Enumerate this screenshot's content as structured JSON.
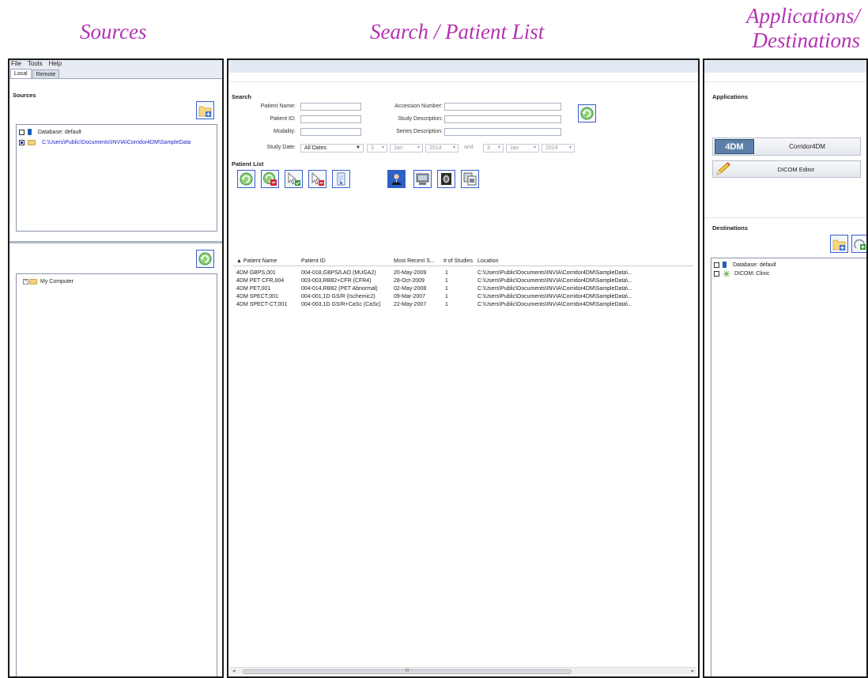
{
  "captions": {
    "sources": "Sources",
    "search": "Search / Patient List",
    "apps_line1": "Applications/",
    "apps_line2": "Destinations"
  },
  "menu": [
    "File",
    "Tools",
    "Help"
  ],
  "tabs": [
    "Local",
    "Remote"
  ],
  "sources": {
    "title": "Sources",
    "items": [
      {
        "label": "Database: default",
        "checked": false
      },
      {
        "label": "C:\\Users\\Public\\Documents\\INVIA\\Corridor4DM\\SampleData",
        "checked": true
      }
    ]
  },
  "tree": {
    "root": "My Computer"
  },
  "search": {
    "title": "Search",
    "patient_name_label": "Patient Name:",
    "patient_id_label": "Patient ID:",
    "modality_label": "Modality:",
    "accession_label": "Accession Number:",
    "study_desc_label": "Study Description:",
    "series_desc_label": "Series Description:",
    "study_date_label": "Study Date:",
    "study_date_value": "All Dates",
    "from_day": "3",
    "from_month": "Jan",
    "from_year": "2014",
    "and_label": "and",
    "to_day": "3",
    "to_month": "Jan",
    "to_year": "2014"
  },
  "patient_list": {
    "title": "Patient List",
    "columns": [
      "▲ Patient Name",
      "Patient ID",
      "Most Recent S...",
      "# of Studies",
      "Location"
    ],
    "rows": [
      [
        "4DM GBPS,001",
        "004-018,GBPS/LAO (MUGA2)",
        "20-May-2009",
        "1",
        "C:\\Users\\Public\\Documents\\INVIA\\Corridor4DM\\SampleData\\..."
      ],
      [
        "4DM PET CFR,004",
        "003-003,RB82+CFR (CFR4)",
        "28-Oct-2009",
        "1",
        "C:\\Users\\Public\\Documents\\INVIA\\Corridor4DM\\SampleData\\..."
      ],
      [
        "4DM PET,001",
        "004-014,RB82 (PET Abnormal)",
        "02-May-2008",
        "1",
        "C:\\Users\\Public\\Documents\\INVIA\\Corridor4DM\\SampleData\\..."
      ],
      [
        "4DM SPECT,001",
        "004-001,1D GS/R (Ischemic2)",
        "09-Mar-2007",
        "1",
        "C:\\Users\\Public\\Documents\\INVIA\\Corridor4DM\\SampleData\\..."
      ],
      [
        "4DM SPECT-CT,001",
        "004-003,1D GS/R+CaSc (CaSc)",
        "22-May-2007",
        "1",
        "C:\\Users\\Public\\Documents\\INVIA\\Corridor4DM\\SampleData\\..."
      ]
    ],
    "scroll_center": "III"
  },
  "applications": {
    "title": "Applications",
    "items": [
      {
        "logo": "4DM",
        "label": "Corridor4DM"
      },
      {
        "label": "DICOM Editor"
      }
    ]
  },
  "destinations": {
    "title": "Destinations",
    "items": [
      {
        "label": "Database: default",
        "checked": false
      },
      {
        "label": "DICOM: Clinic",
        "checked": false
      }
    ]
  },
  "colors": {
    "caption": "#b233b2",
    "accent_blue": "#3a5ecf",
    "link_blue": "#2222cc",
    "panel_header": "#e3e9f2"
  },
  "icons": [
    "add-folder-icon",
    "refresh-icon",
    "delete-icon",
    "select-all-icon",
    "deselect-icon",
    "log-icon",
    "patient-icon",
    "monitor-icon",
    "image-icon",
    "copy-icon",
    "pencil-icon",
    "dicom-network-icon",
    "database-icon",
    "folder-icon"
  ]
}
